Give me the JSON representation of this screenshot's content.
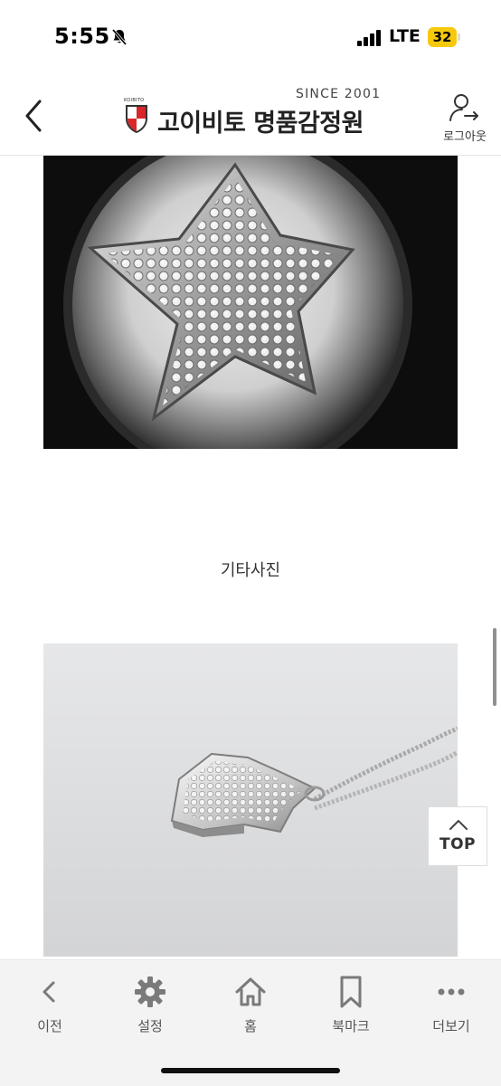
{
  "status_bar": {
    "time": "5:55",
    "network": "LTE",
    "battery_level": "32",
    "icons": [
      "bell-slash-icon",
      "signal-bars-icon",
      "battery-icon"
    ],
    "battery_color": "#f6c90e"
  },
  "header": {
    "since": "SINCE 2001",
    "logo_mark": "KOIBITO",
    "brand_name": "고이비토 명품감정원",
    "logout_label": "로그아웃",
    "brand_red": "#d9262b"
  },
  "content": {
    "section_title": "기타사진",
    "top_label": "TOP"
  },
  "toolbar": {
    "items": [
      {
        "label": "이전",
        "icon": "chevron-left-icon"
      },
      {
        "label": "설정",
        "icon": "gear-icon"
      },
      {
        "label": "홈",
        "icon": "home-icon"
      },
      {
        "label": "북마크",
        "icon": "bookmark-icon"
      },
      {
        "label": "더보기",
        "icon": "more-dots-icon"
      }
    ],
    "icon_color": "#7a7a7a"
  }
}
